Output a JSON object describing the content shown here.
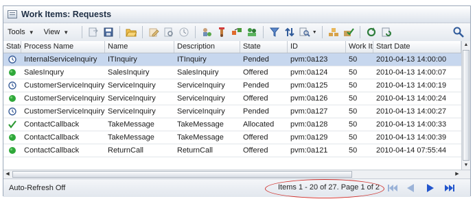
{
  "window": {
    "title": "Work Items: Requests"
  },
  "toolbar": {
    "tools_label": "Tools",
    "view_label": "View"
  },
  "table": {
    "columns": [
      "State",
      "Process Name",
      "Name",
      "Description",
      "State",
      "ID",
      "Work Item Priority",
      "Start Date"
    ],
    "rows": [
      {
        "icon": "clock",
        "process": "InternalServiceInquiry",
        "name": "ITInquiry",
        "description": "ITInquiry",
        "state": "Pended",
        "id": "pvm:0a123",
        "priority": "50",
        "start": "2010-04-13 14:00:00",
        "selected": true
      },
      {
        "icon": "green",
        "process": "SalesInqury",
        "name": "SalesInquiry",
        "description": "SalesInquiry",
        "state": "Offered",
        "id": "pvm:0a124",
        "priority": "50",
        "start": "2010-04-13 14:00:07"
      },
      {
        "icon": "clock",
        "process": "CustomerServiceInquiry",
        "name": "ServiceInquiry",
        "description": "ServiceInquiry",
        "state": "Pended",
        "id": "pvm:0a125",
        "priority": "50",
        "start": "2010-04-13 14:00:19"
      },
      {
        "icon": "green",
        "process": "CustomerServiceInquiry",
        "name": "ServiceInquiry",
        "description": "ServiceInquiry",
        "state": "Offered",
        "id": "pvm:0a126",
        "priority": "50",
        "start": "2010-04-13 14:00:24"
      },
      {
        "icon": "clock",
        "process": "CustomerServiceInquiry",
        "name": "ServiceInquiry",
        "description": "ServiceInquiry",
        "state": "Pended",
        "id": "pvm:0a127",
        "priority": "50",
        "start": "2010-04-13 14:00:27"
      },
      {
        "icon": "check",
        "process": "ContactCallback",
        "name": "TakeMessage",
        "description": "TakeMessage",
        "state": "Allocated",
        "id": "pvm:0a128",
        "priority": "50",
        "start": "2010-04-13 14:00:33"
      },
      {
        "icon": "green",
        "process": "ContactCallback",
        "name": "TakeMessage",
        "description": "TakeMessage",
        "state": "Offered",
        "id": "pvm:0a129",
        "priority": "50",
        "start": "2010-04-13 14:00:39"
      },
      {
        "icon": "green",
        "process": "ContactCallback",
        "name": "ReturnCall",
        "description": "ReturnCall",
        "state": "Offered",
        "id": "pvm:0a121",
        "priority": "50",
        "start": "2010-04-14 07:55:44"
      }
    ]
  },
  "status": {
    "auto_refresh": "Auto-Refresh Off",
    "page_info": "Items 1 - 20 of 27. Page 1 of 2"
  },
  "colors": {
    "selected_row": "#c7d7ee",
    "highlight_oval": "#d0312d",
    "nav_arrow": "#2255cc"
  }
}
